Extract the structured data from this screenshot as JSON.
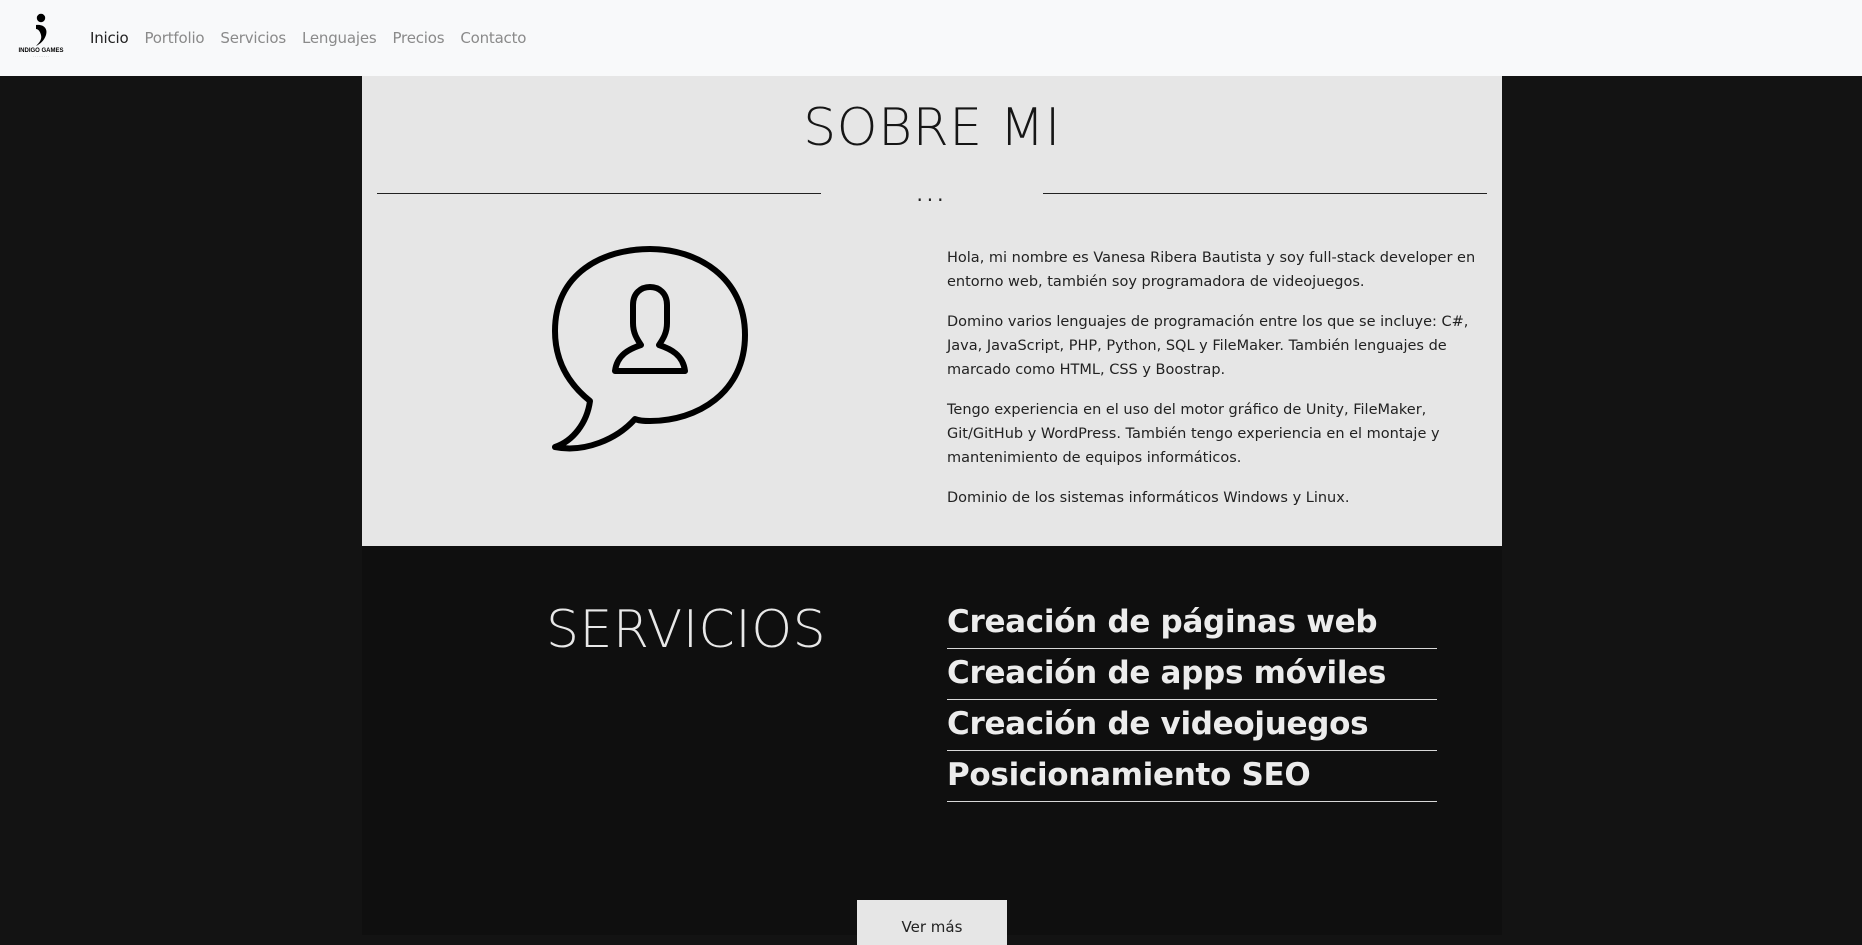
{
  "nav": {
    "logo_text": "INDIGO GAMES",
    "logo_subtext": "· · · · · · · · ·",
    "links": [
      "Inicio",
      "Portfolio",
      "Servicios",
      "Lenguajes",
      "Precios",
      "Contacto"
    ]
  },
  "about": {
    "title": "SOBRE MI",
    "divider": "...",
    "paragraphs": [
      "Hola, mi nombre es Vanesa Ribera Bautista y soy full-stack developer en entorno web, también soy programadora de videojuegos.",
      "Domino varios lenguajes de programación entre los que se incluye: C#, Java, JavaScript, PHP, Python, SQL y FileMaker. También lenguajes de marcado como HTML, CSS y Boostrap.",
      "Tengo experiencia en el uso del motor gráfico de Unity, FileMaker, Git/GitHub y WordPress. También tengo experiencia en el montaje y mantenimiento de equipos informáticos.",
      "Dominio de los sistemas informáticos Windows y Linux."
    ],
    "icon": "user-speech-bubble-icon"
  },
  "services": {
    "title": "SERVICIOS",
    "items": [
      "Creación de páginas web",
      "Creación de apps móviles",
      "Creación de videojuegos",
      "Posicionamiento SEO"
    ],
    "button_label": "Ver más"
  },
  "colors": {
    "navbar_bg": "#f8f9fa",
    "page_bg": "#131313",
    "about_bg": "#e6e6e6",
    "services_bg": "#0f0f0f"
  }
}
